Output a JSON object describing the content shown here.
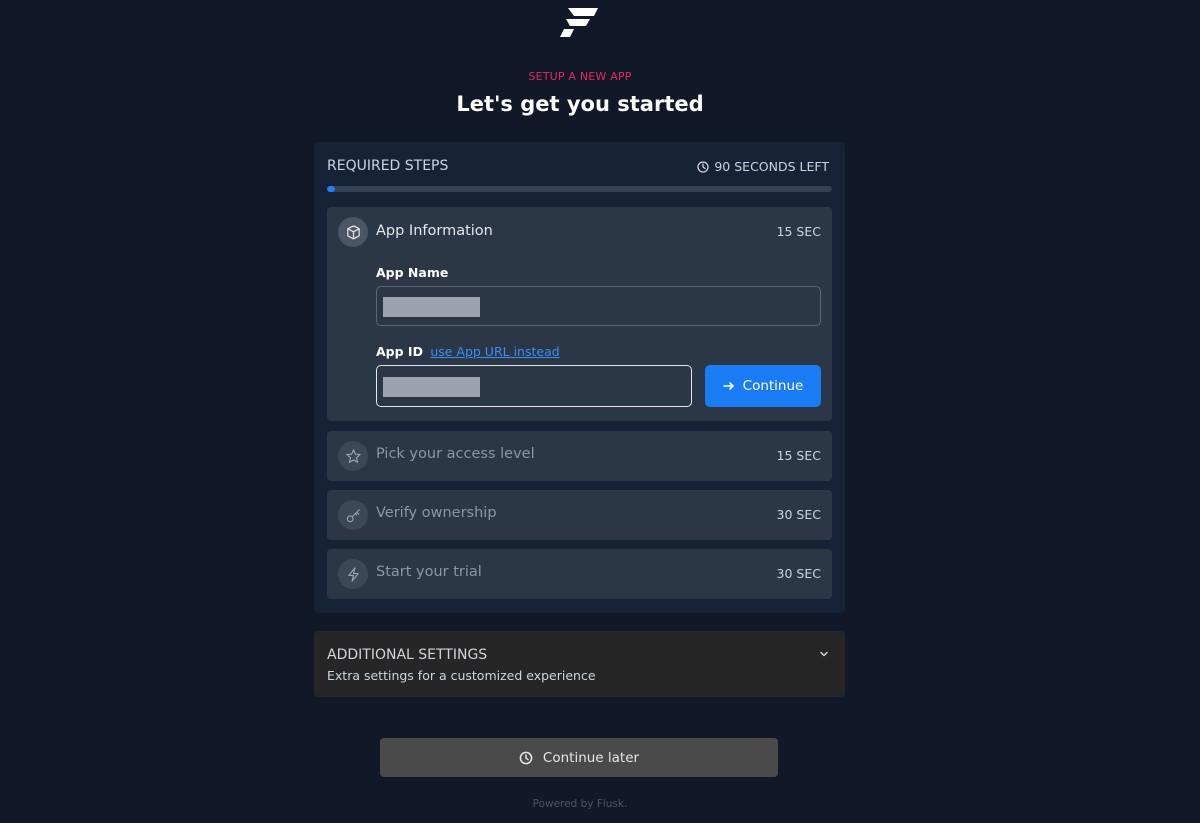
{
  "header": {
    "eyebrow": "SETUP A NEW APP",
    "title": "Let's get you started"
  },
  "required_steps": {
    "title": "REQUIRED STEPS",
    "timer": "90 SECONDS LEFT",
    "progress_fraction": 0.015,
    "steps": [
      {
        "label": "App Information",
        "time": "15 SEC",
        "icon": "cube-icon",
        "state": "active"
      },
      {
        "label": "Pick your access level",
        "time": "15 SEC",
        "icon": "star-icon",
        "state": "inactive"
      },
      {
        "label": "Verify ownership",
        "time": "30 SEC",
        "icon": "key-icon",
        "state": "inactive"
      },
      {
        "label": "Start your trial",
        "time": "30 SEC",
        "icon": "lightning-icon",
        "state": "inactive"
      }
    ]
  },
  "form": {
    "app_name_label": "App Name",
    "app_id_label": "App ID",
    "app_id_link": "use App URL instead",
    "continue_label": "Continue"
  },
  "additional_settings": {
    "title": "ADDITIONAL SETTINGS",
    "subtitle": "Extra settings for a customized experience"
  },
  "footer": {
    "continue_later": "Continue later",
    "powered_by": "Powered by Flusk."
  },
  "colors": {
    "background": "#111827",
    "accent": "#1a7cf5",
    "eyebrow": "#e7265e"
  }
}
